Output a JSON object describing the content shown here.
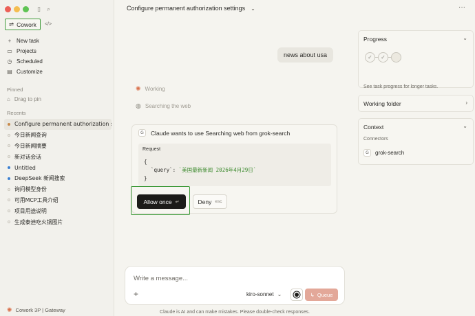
{
  "sidebar": {
    "mode": {
      "label": "Cowork",
      "code_icon": "</>"
    },
    "nav": [
      {
        "icon": "plus-icon",
        "glyph": "+",
        "label": "New task"
      },
      {
        "icon": "folder-icon",
        "glyph": "▭",
        "label": "Projects"
      },
      {
        "icon": "clock-icon",
        "glyph": "◷",
        "label": "Scheduled"
      },
      {
        "icon": "briefcase-icon",
        "glyph": "▤",
        "label": "Customize"
      }
    ],
    "pinned_label": "Pinned",
    "drag_to_pin": "Drag to pin",
    "recents_label": "Recents",
    "recents": [
      {
        "label": "Configure permanent authorization s",
        "dot": "orange",
        "active": true
      },
      {
        "label": "今日新闻查询",
        "dot": "hollow"
      },
      {
        "label": "今日新闻摘要",
        "dot": "hollow"
      },
      {
        "label": "新对话会话",
        "dot": "hollow"
      },
      {
        "label": "Untitled",
        "dot": "blue"
      },
      {
        "label": "DeepSeek 新闻搜索",
        "dot": "blue"
      },
      {
        "label": "询问模型身份",
        "dot": "hollow"
      },
      {
        "label": "可用MCP工具介绍",
        "dot": "hollow"
      },
      {
        "label": "项目用途说明",
        "dot": "hollow"
      },
      {
        "label": "生成泰迪吃火锅图片",
        "dot": "hollow"
      }
    ],
    "footer": "Cowork 3P | Gateway"
  },
  "header": {
    "title": "Configure permanent authorization settings",
    "more_icon": "···"
  },
  "conversation": {
    "user_message": "news about usa",
    "working_label": "Working",
    "searching_label": "Searching the web"
  },
  "permission_card": {
    "server_badge": "G",
    "prompt": "Claude wants to use Searching web from grok-search",
    "request_label": "Request",
    "code_open": "{",
    "code_key": "`query`",
    "code_sep": ": ",
    "code_value": "`美国最新新闻 2026年4月29日`",
    "code_close": "}",
    "allow_label": "Allow once",
    "allow_kbd": "↵",
    "deny_label": "Deny",
    "deny_kbd": "esc"
  },
  "composer": {
    "placeholder": "Write a message...",
    "model": "kiro-sonnet",
    "queue_label": "Queue",
    "disclaimer": "Claude is AI and can make mistakes. Please double-check responses."
  },
  "right_panel": {
    "progress": {
      "title": "Progress",
      "note": "See task progress for longer tasks."
    },
    "working_folder": {
      "title": "Working folder"
    },
    "context": {
      "title": "Context",
      "connectors_label": "Connectors",
      "connector": "grok-search",
      "connector_badge": "G"
    }
  }
}
